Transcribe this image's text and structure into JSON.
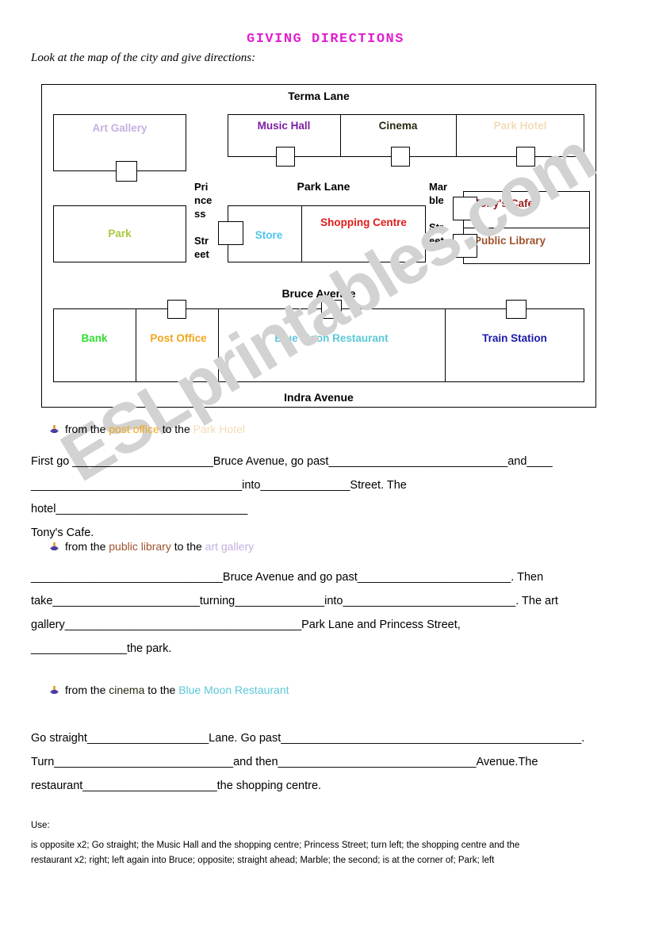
{
  "page": {
    "title": "GIVING DIRECTIONS",
    "instruction": "Look at the map of the city and give directions:",
    "watermark": "ESLprintables.com",
    "title_color": "#e020d0",
    "watermark_color": "#d2d2d2"
  },
  "map": {
    "streets": {
      "top": "Terma Lane",
      "middle": "Park Lane",
      "lower": "Bruce Avenue",
      "bottom": "Indra Avenue",
      "left_vertical": [
        "Pri",
        "nce",
        "ss",
        "Str",
        "eet"
      ],
      "right_vertical": [
        "Mar",
        "ble",
        "Str",
        "eet"
      ],
      "left_vertical_full": "Princess Street",
      "right_vertical_full": "Marble Street"
    },
    "buildings": [
      {
        "name": "Art Gallery",
        "color": "#c6b0e0",
        "row": "top",
        "door": "bottom"
      },
      {
        "name": "Music Hall",
        "color": "#7b1fa2",
        "row": "top",
        "door": "bottom"
      },
      {
        "name": "Cinema",
        "color": "#2a2a12",
        "row": "top",
        "door": "bottom"
      },
      {
        "name": "Park Hotel",
        "color": "#f3dcb6",
        "row": "top",
        "door": "bottom"
      },
      {
        "name": "Park",
        "color": "#a8c83c",
        "row": "middle",
        "door": "none"
      },
      {
        "name": "Store",
        "color": "#4dc6ef",
        "row": "middle",
        "door": "left"
      },
      {
        "name": "Shopping Centre",
        "color": "#e01b1b",
        "row": "middle",
        "door": "none"
      },
      {
        "name": "Tony's Cafe",
        "color": "#9b1b1b",
        "row": "middle",
        "door": "left"
      },
      {
        "name": "Public Library",
        "color": "#a0522d",
        "row": "middle",
        "door": "left"
      },
      {
        "name": "Bank",
        "color": "#33dd33",
        "row": "bottom",
        "door": "none"
      },
      {
        "name": "Post Office",
        "color": "#f0a61e",
        "row": "bottom",
        "door": "top"
      },
      {
        "name": "Blue Moon Restaurant",
        "color": "#5bc8d8",
        "row": "bottom",
        "door": "top"
      },
      {
        "name": "Train Station",
        "color": "#1a1aa8",
        "row": "bottom",
        "door": "top"
      }
    ]
  },
  "exercises": [
    {
      "head": {
        "pre": "from the ",
        "from": "post office",
        "from_color": "#f0a61e",
        "mid": " to the ",
        "to": "Park Hotel",
        "to_color": "#f3dcb6"
      },
      "lines": [
        "First go ______________________Bruce Avenue, go past____________________________and____",
        "_________________________________into______________Street. The hotel______________________________",
        "Tony's Cafe."
      ]
    },
    {
      "head": {
        "pre": "from the ",
        "from": "public library",
        "from_color": "#a0522d",
        "mid": " to the ",
        "to": "art gallery",
        "to_color": "#c6b0e0"
      },
      "lines": [
        "______________________________Bruce Avenue and go past________________________. Then",
        "take_______________________turning______________into___________________________. The art",
        "gallery_____________________________________Park Lane and Princess Street,",
        "_______________the park."
      ]
    },
    {
      "head": {
        "pre": "from the ",
        "from": "cinema",
        "from_color": "#2a2a12",
        "mid": " to the ",
        "to": "Blue Moon Restaurant",
        "to_color": "#5bc8d8"
      },
      "lines": [
        "Go straight___________________Lane. Go past_______________________________________________.",
        "Turn____________________________and then_______________________________Avenue.The",
        "restaurant_____________________the shopping centre."
      ]
    }
  ],
  "word_bank": {
    "label": "Use:",
    "lines": [
      "is opposite x2; Go straight; the Music Hall and the shopping centre; Princess Street; turn left; the shopping centre and the",
      "restaurant x2; right; left again into Bruce; opposite; straight ahead; Marble; the second; is at the corner of; Park; left"
    ]
  }
}
